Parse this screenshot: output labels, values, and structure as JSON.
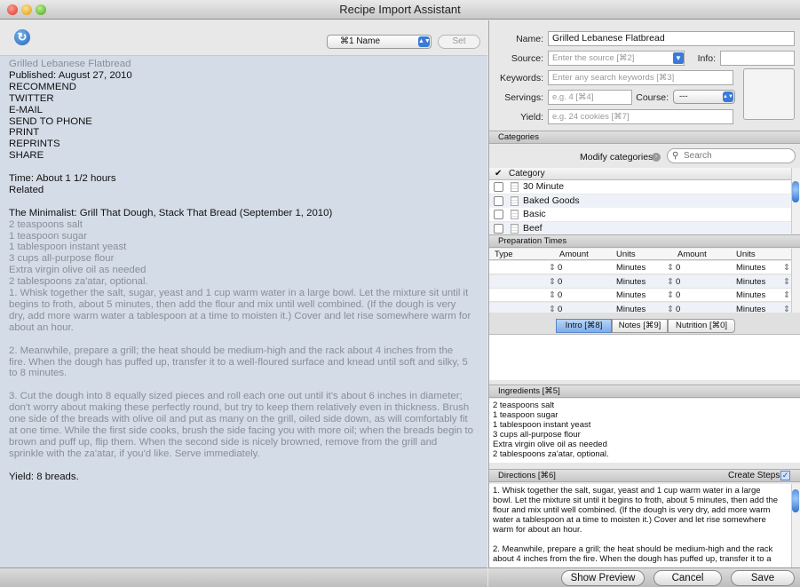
{
  "window": {
    "title": "Recipe Import Assistant"
  },
  "left": {
    "field_select": "⌘1 Name",
    "set_label": "Set",
    "lines": [
      {
        "t": "Grilled Lebanese Flatbread",
        "c": "g"
      },
      {
        "t": "Published: August 27, 2010",
        "c": "k"
      },
      {
        "t": "RECOMMEND",
        "c": "k"
      },
      {
        "t": "TWITTER",
        "c": "k"
      },
      {
        "t": "E-MAIL",
        "c": "k"
      },
      {
        "t": "SEND TO PHONE",
        "c": "k"
      },
      {
        "t": "PRINT",
        "c": "k"
      },
      {
        "t": "REPRINTS",
        "c": "k"
      },
      {
        "t": "SHARE",
        "c": "k"
      },
      {
        "t": "",
        "c": "k"
      },
      {
        "t": "Time: About 1 1/2 hours",
        "c": "k"
      },
      {
        "t": "Related",
        "c": "k"
      },
      {
        "t": "",
        "c": "k"
      },
      {
        "t": "The Minimalist: Grill That Dough, Stack That Bread (September 1, 2010)",
        "c": "k"
      },
      {
        "t": "2 teaspoons salt",
        "c": "g"
      },
      {
        "t": "1 teaspoon sugar",
        "c": "g"
      },
      {
        "t": "1 tablespoon instant yeast",
        "c": "g"
      },
      {
        "t": "3 cups all-purpose flour",
        "c": "g"
      },
      {
        "t": "Extra virgin olive oil as needed",
        "c": "g"
      },
      {
        "t": "2 tablespoons za'atar, optional.",
        "c": "g"
      },
      {
        "t": "1. Whisk together the salt, sugar, yeast and 1 cup warm water in a large bowl. Let the mixture sit until it",
        "c": "g"
      },
      {
        "t": "begins to froth, about 5 minutes, then add the flour and mix until well combined. (If the dough is very",
        "c": "g"
      },
      {
        "t": "dry, add more warm water a tablespoon at a time to moisten it.) Cover and let rise somewhere warm for",
        "c": "g"
      },
      {
        "t": "about an hour.",
        "c": "g"
      },
      {
        "t": "",
        "c": "g"
      },
      {
        "t": "2. Meanwhile, prepare a grill; the heat should be medium-high and the rack about 4 inches from the",
        "c": "g"
      },
      {
        "t": "fire. When the dough has puffed up, transfer it to a well-floured surface and knead until soft and silky, 5",
        "c": "g"
      },
      {
        "t": "to 8 minutes.",
        "c": "g"
      },
      {
        "t": "",
        "c": "g"
      },
      {
        "t": "3. Cut the dough into 8 equally sized pieces and roll each one out until it's about 6 inches in diameter;",
        "c": "g"
      },
      {
        "t": "don't worry about making these perfectly round, but try to keep them relatively even in thickness. Brush",
        "c": "g"
      },
      {
        "t": "one side of the breads with olive oil and put as many on the grill, oiled side down, as will comfortably fit",
        "c": "g"
      },
      {
        "t": "at one time. While the first side cooks, brush the side facing you with more oil; when the breads begin to",
        "c": "g"
      },
      {
        "t": "brown and puff up, flip them. When the second side is nicely browned, remove from the grill and",
        "c": "g"
      },
      {
        "t": "sprinkle with the za'atar, if you'd like. Serve immediately.",
        "c": "g"
      },
      {
        "t": "",
        "c": "g"
      },
      {
        "t": "Yield: 8 breads.",
        "c": "k"
      }
    ]
  },
  "form": {
    "name_label": "Name:",
    "name_value": "Grilled Lebanese Flatbread",
    "source_label": "Source:",
    "source_placeholder": "Enter the source [⌘2]",
    "info_label": "Info:",
    "keywords_label": "Keywords:",
    "keywords_placeholder": "Enter any search keywords [⌘3]",
    "servings_label": "Servings:",
    "servings_placeholder": "e.g. 4 [⌘4]",
    "course_label": "Course:",
    "course_value": "---",
    "yield_label": "Yield:",
    "yield_placeholder": "e.g. 24 cookies [⌘7]"
  },
  "categories": {
    "header": "Categories",
    "modify_label": "Modify categories",
    "search_placeholder": "Search",
    "col_check": "✔",
    "col_category": "Category",
    "items": [
      "30 Minute",
      "Baked Goods",
      "Basic",
      "Beef"
    ]
  },
  "prep": {
    "header": "Preparation Times",
    "cols": [
      "Type",
      "Amount",
      "Units",
      "Amount",
      "Units"
    ],
    "rows": [
      {
        "a1": "0",
        "u1": "Minutes",
        "a2": "0",
        "u2": "Minutes"
      },
      {
        "a1": "0",
        "u1": "Minutes",
        "a2": "0",
        "u2": "Minutes"
      },
      {
        "a1": "0",
        "u1": "Minutes",
        "a2": "0",
        "u2": "Minutes"
      },
      {
        "a1": "0",
        "u1": "Minutes",
        "a2": "0",
        "u2": "Minutes"
      }
    ]
  },
  "tabs": [
    "Intro [⌘8]",
    "Notes [⌘9]",
    "Nutrition [⌘0]"
  ],
  "ingredients": {
    "header": "Ingredients [⌘5]",
    "lines": [
      "2 teaspoons salt",
      "1 teaspoon sugar",
      "1 tablespoon instant yeast",
      "3 cups all-purpose flour",
      "Extra virgin olive oil as needed",
      "2 tablespoons za'atar, optional."
    ]
  },
  "directions": {
    "header": "Directions [⌘6]",
    "create_steps": "Create Steps",
    "lines": [
      "1. Whisk together the salt, sugar, yeast and 1 cup warm water in a large",
      "bowl. Let the mixture sit until it begins to froth, about 5 minutes, then add the",
      "flour and mix until well combined. (If the dough is very dry, add more warm",
      "water a tablespoon at a time to moisten it.) Cover and let rise somewhere",
      "warm for about an hour.",
      "",
      "2. Meanwhile, prepare a grill; the heat should be medium-high and the rack",
      "about 4 inches from the fire. When the dough has puffed up, transfer it to a"
    ]
  },
  "buttons": {
    "preview": "Show Preview",
    "cancel": "Cancel",
    "save": "Save"
  }
}
